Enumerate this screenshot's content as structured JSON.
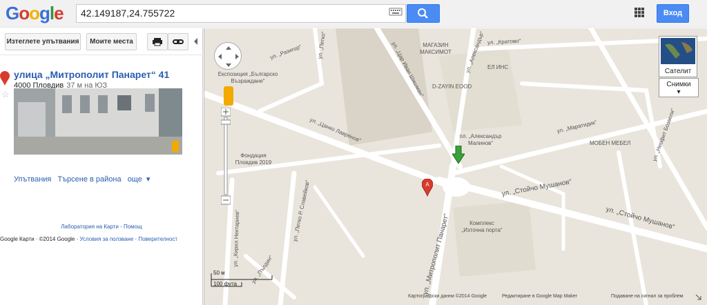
{
  "header": {
    "logo_letters": [
      "G",
      "o",
      "o",
      "g",
      "l",
      "e"
    ],
    "search_value": "42.149187,24.755722",
    "signin_label": "Вход",
    "icons": [
      "keyboard-icon",
      "search-icon",
      "apps-grid-icon"
    ]
  },
  "panel": {
    "directions_button": "Изтеглете упътвания",
    "my_places_button": "Моите места",
    "address_title": "улица „Митрополит Панарет“ 41",
    "address_postal": "4000 Пловдив",
    "address_distance": "37 м на ЮЗ",
    "actions": [
      "Упътвания",
      "Търсене в района",
      "още"
    ],
    "lab_link": "Лаборатория на Карти",
    "help_link": "Помощ",
    "footer_brand": "Google Карти",
    "footer_copy": "©2014 Google",
    "terms_link": "Условия за ползване",
    "privacy_link": "Поверителност"
  },
  "map": {
    "streets": [
      "ул. „Разигор“",
      "ул. „Цар Иван Шишман“",
      "ул. „Кратово“",
      "ул. „Александър“",
      "ул. „Цанко Лавренов“",
      "ул. „Маратидик“",
      "ул. „Стойчо Мушанов“",
      "ул. „Стойчо Мушанов“",
      "ул. „Митрополит Панарет“",
      "ул. „Петко Р. Славейков“",
      "ул. „Кирил Нектариев“",
      "ул. „Пълдин“",
      "ул. „Неофит Бозвели“",
      "ул. „Петко“"
    ],
    "pois": {
      "museum": "Експозиция „Българско Възраждане“",
      "shop": "МАГАЗИН МАКСИМОТ",
      "el_ins": "ЕЛ ИНС",
      "dzayin": "D-ZAYIN EOOD",
      "square": "пл. „Александър Малинов“",
      "mobel": "МОБЕН МЕБЕЛ",
      "fondacia": "Фондация Пловдив 2019",
      "complex": "Комплекс „Източна порта“"
    },
    "satellite_label": "Сателит",
    "photos_label": "Снимки",
    "scale_m": "50 м",
    "scale_ft": "100 фута",
    "copyright": "Картографски данни ©2014 Google",
    "edit_link": "Редактиране в Google Map Maker",
    "report_link": "Подаване на сигнал за проблем",
    "marker_label": "A"
  },
  "colors": {
    "search_blue": "#4b8bf4",
    "link_blue": "#2a5db0",
    "map_bg": "#e9e5dc",
    "road": "#ffffff",
    "block": "#d9d4c7",
    "marker_red": "#d83b2e",
    "arrow_green": "#3aa03a"
  }
}
